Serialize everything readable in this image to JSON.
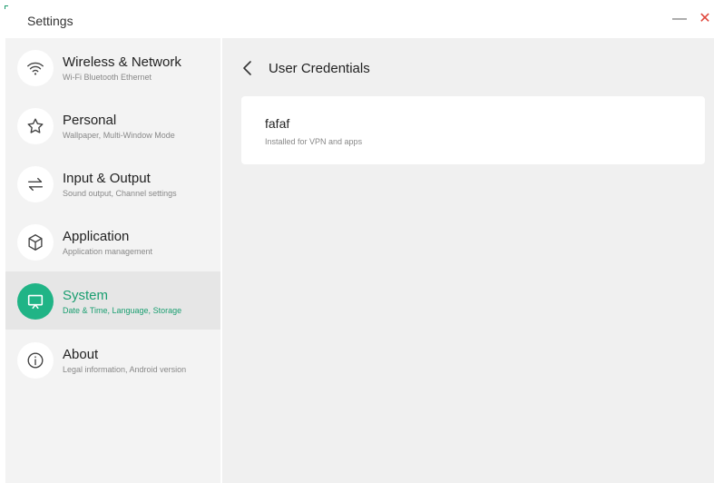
{
  "window": {
    "title": "Settings",
    "minimize_glyph": "—",
    "close_glyph": "✕"
  },
  "sidebar": {
    "items": [
      {
        "label": "Wireless & Network",
        "subtitle": "Wi-Fi Bluetooth Ethernet",
        "icon": "wifi-icon"
      },
      {
        "label": "Personal",
        "subtitle": "Wallpaper, Multi-Window Mode",
        "icon": "star-icon"
      },
      {
        "label": "Input & Output",
        "subtitle": "Sound output, Channel settings",
        "icon": "swap-arrows-icon"
      },
      {
        "label": "Application",
        "subtitle": "Application management",
        "icon": "cube-icon"
      },
      {
        "label": "System",
        "subtitle": "Date & Time, Language, Storage",
        "icon": "monitor-icon",
        "selected": true
      },
      {
        "label": "About",
        "subtitle": "Legal information, Android version",
        "icon": "info-icon"
      }
    ]
  },
  "main": {
    "title": "User Credentials",
    "credentials": [
      {
        "name": "fafaf",
        "description": "Installed for VPN and apps"
      }
    ]
  },
  "colors": {
    "accent": "#20b486",
    "accent_text": "#1a9e70",
    "close": "#e0453a",
    "sidebar_bg": "#f3f3f3",
    "content_bg": "#f0f0f0"
  }
}
